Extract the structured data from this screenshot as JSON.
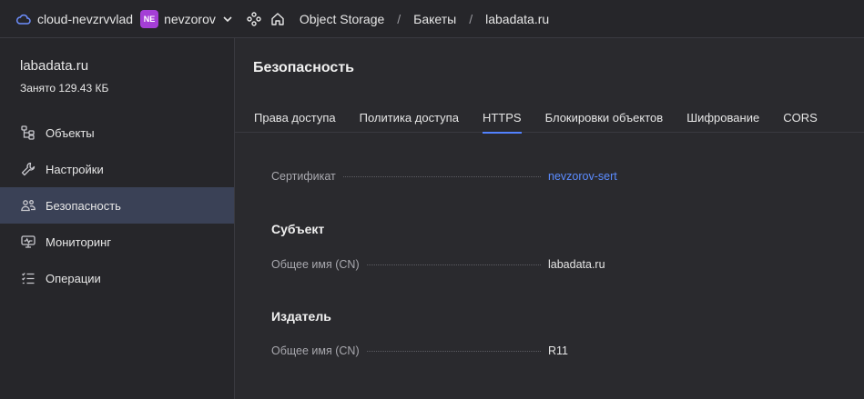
{
  "topbar": {
    "cloud_name": "cloud-nevzrvvlad",
    "avatar_initials": "NE",
    "user_name": "nevzorov",
    "breadcrumbs": [
      "Object Storage",
      "Бакеты",
      "labadata.ru"
    ],
    "separator": "/"
  },
  "sidebar": {
    "bucket_name": "labadata.ru",
    "usage": "Занято 129.43 КБ",
    "items": [
      {
        "label": "Объекты",
        "icon": "objects-icon"
      },
      {
        "label": "Настройки",
        "icon": "wrench-icon"
      },
      {
        "label": "Безопасность",
        "icon": "users-icon",
        "active": true
      },
      {
        "label": "Мониторинг",
        "icon": "monitor-icon"
      },
      {
        "label": "Операции",
        "icon": "list-icon"
      }
    ]
  },
  "main": {
    "title": "Безопасность",
    "tabs": [
      {
        "label": "Права доступа"
      },
      {
        "label": "Политика доступа"
      },
      {
        "label": "HTTPS",
        "active": true
      },
      {
        "label": "Блокировки объектов"
      },
      {
        "label": "Шифрование"
      },
      {
        "label": "CORS"
      }
    ],
    "certificate": {
      "label": "Сертификат",
      "value": "nevzorov-sert"
    },
    "subject": {
      "title": "Субъект",
      "cn_label": "Общее имя (CN)",
      "cn_value": "labadata.ru"
    },
    "issuer": {
      "title": "Издатель",
      "cn_label": "Общее имя (CN)",
      "cn_value": "R11"
    }
  },
  "colors": {
    "accent": "#5282ff",
    "link": "#5b8cff",
    "avatar_bg": "#a43ed6",
    "active_nav_bg": "#3a4156"
  }
}
